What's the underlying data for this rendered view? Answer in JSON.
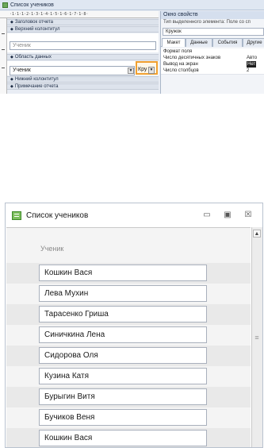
{
  "design_window": {
    "title": "Список учеников",
    "ruler_text": "·1·1·1·2·1·3·1·4·1·5·1·6·1·7·1·8·",
    "bands": {
      "report_header": "Заголовок отчета",
      "page_header": "Верхний колонтитул",
      "detail": "Область данных",
      "page_footer": "Нижний колонтитул",
      "report_footer": "Примечание отчета"
    },
    "header_field": "Ученик",
    "detail_field": "Ученик",
    "selected_control": "Кру",
    "property_sheet": {
      "title": "Окно свойств",
      "type_label": "Тип выделенного элемента:  Поле со сп",
      "selected": "Кружок",
      "tabs": [
        "Макет",
        "Данные",
        "События",
        "Другие"
      ],
      "rows": [
        {
          "name": "Формат поля",
          "value": ""
        },
        {
          "name": "Число десятичных знаков",
          "value": "Авто"
        },
        {
          "name": "Вывод на экран",
          "value": "Нет"
        },
        {
          "name": "Число столбцов",
          "value": "2"
        }
      ]
    }
  },
  "form_window": {
    "title": "Список учеников",
    "buttons": {
      "minimize": "▭",
      "maximize": "▣",
      "close": "☒"
    },
    "label": "Ученик",
    "records": [
      "Кошкин Вася",
      "Лева Мухин",
      "Тарасенко Гриша",
      "Синичкина Лена",
      "Сидорова Оля",
      "Кузина Катя",
      "Бурыгин Витя",
      "Бучиков Веня",
      "Кошкин Вася"
    ],
    "scroll_up": "▲",
    "scroll_grip": "≡"
  }
}
